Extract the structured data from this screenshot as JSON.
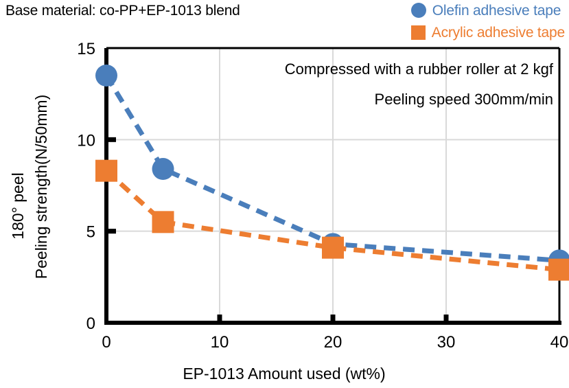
{
  "header": {
    "base_material_text": "Base material: co-PP+EP-1013 blend"
  },
  "legend": {
    "items": [
      {
        "label": "Olefin adhesive tape",
        "marker": "circle",
        "color": "#4A7EBB"
      },
      {
        "label": "Acrylic adhesive tape",
        "marker": "square",
        "color": "#ED7D31"
      }
    ]
  },
  "annotations": {
    "line1": "Compressed with a rubber roller at 2 kgf",
    "line2": "Peeling speed 300mm/min"
  },
  "axis_title": {
    "y_line1": "180° peel",
    "y_line2": "Peeling strength(N/50mm)",
    "x": "EP-1013 Amount used (wt%)"
  },
  "ticks": {
    "x": [
      "0",
      "10",
      "20",
      "30",
      "40"
    ],
    "y": [
      "0",
      "5",
      "10",
      "15"
    ]
  },
  "chart_data": {
    "type": "line",
    "title": "Base material: co-PP+EP-1013 blend",
    "xlabel": "EP-1013 Amount used (wt%)",
    "ylabel": "180° peel Peeling strength(N/50mm)",
    "xlim": [
      0,
      40
    ],
    "ylim": [
      0,
      15
    ],
    "xticks": [
      0,
      10,
      20,
      30,
      40
    ],
    "yticks": [
      0,
      5,
      10,
      15
    ],
    "grid": "horizontal-and-vertical-light",
    "legend_position": "top-right-outside",
    "linestyle": "dashed",
    "x": [
      0,
      5,
      20,
      40
    ],
    "series": [
      {
        "name": "Olefin adhesive tape",
        "color": "#4A7EBB",
        "marker": "circle",
        "values": [
          13.5,
          8.4,
          4.3,
          3.4
        ]
      },
      {
        "name": "Acrylic adhesive tape",
        "color": "#ED7D31",
        "marker": "square",
        "values": [
          8.3,
          5.5,
          4.1,
          2.9
        ]
      }
    ],
    "annotations": [
      "Compressed with a rubber roller at 2 kgf",
      "Peeling speed 300mm/min"
    ]
  }
}
